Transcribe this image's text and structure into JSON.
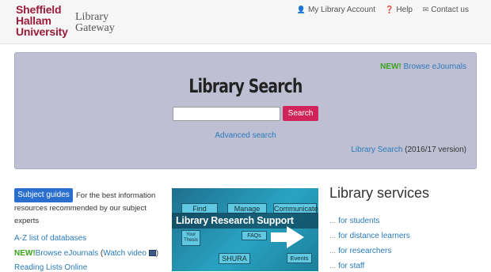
{
  "header": {
    "logo_lines": [
      "Sheffield",
      "Hallam",
      "University"
    ],
    "gateway_lines": [
      "Library",
      "Gateway"
    ],
    "nav": {
      "account": "My Library Account",
      "help": "Help",
      "contact": "Contact us"
    },
    "nav_icons": [
      "user-icon",
      "question-icon",
      "envelope-icon"
    ]
  },
  "search": {
    "new_badge": "NEW!",
    "browse_ejournals": "Browse eJournals",
    "title": "Library Search",
    "input_value": "",
    "input_placeholder": "",
    "button_label": "Search",
    "advanced_label": "Advanced search",
    "old_link": "Library Search",
    "old_suffix": " (2016/17 version)"
  },
  "left": {
    "subject_button": "Subject guides",
    "subject_text": "For the best information resources recommended by our subject experts",
    "az_link": "A-Z list of databases",
    "new_badge": "NEW!",
    "ejournals_link": "Browse eJournals",
    "watch_open": " (",
    "watch_link": "Watch video",
    "watch_close": ")",
    "reading_lists": "Reading Lists Online"
  },
  "banner": {
    "find": "Find",
    "manage": "Manage",
    "communicate": "Communicate",
    "title": "Library Research Support",
    "thesis": "Your Thesis",
    "faqs": "FAQs",
    "shura": "SHURA",
    "events": "Events"
  },
  "services": {
    "title": "Library services",
    "dots": "...",
    "items": [
      "for students",
      "for distance learners",
      "for researchers",
      "for staff"
    ]
  },
  "colors": {
    "brand": "#9b1c3a",
    "panel_bg": "#bfbfd4",
    "search_button": "#d0245a",
    "subject_button": "#2a6fcf",
    "link": "#2a7ab8",
    "new": "#3aa31a"
  }
}
